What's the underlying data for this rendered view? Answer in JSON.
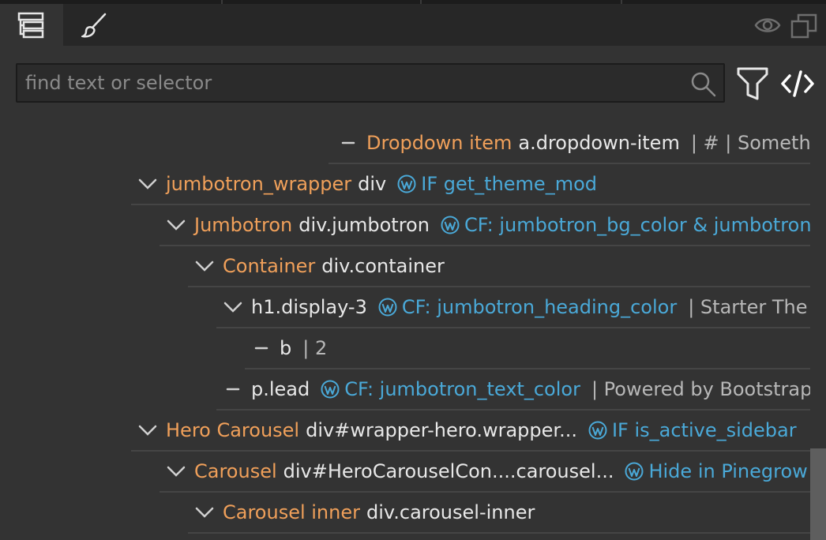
{
  "toolbar": {
    "tabs": [
      {
        "name": "tree-tab",
        "icon": "tree-icon"
      },
      {
        "name": "style-tab",
        "icon": "brush-icon"
      }
    ],
    "right_icons": [
      "eye-icon",
      "duplicate-icon"
    ]
  },
  "search": {
    "placeholder": "find text or selector",
    "value": ""
  },
  "tree": [
    {
      "indent": 0,
      "control": "leaf",
      "name": "Dropdown item",
      "selector": "a.dropdown-item",
      "meta": "| # | Someth"
    },
    {
      "indent": 0,
      "control": "expanded",
      "name": "jumbotron_wrapper",
      "selector": "div",
      "wp": "IF get_theme_mod"
    },
    {
      "indent": 1,
      "control": "expanded",
      "name": "Jumbotron",
      "selector": "div.jumbotron",
      "wp": "CF: jumbotron_bg_color & jumbotron"
    },
    {
      "indent": 2,
      "control": "expanded",
      "name": "Container",
      "selector": "div.container"
    },
    {
      "indent": 3,
      "control": "expanded",
      "name": "",
      "selector": "h1.display-3",
      "wp": "CF: jumbotron_heading_color",
      "meta": "| Starter The"
    },
    {
      "indent": 4,
      "control": "leaf",
      "name": "",
      "selector": "b",
      "meta": "| 2"
    },
    {
      "indent": 3,
      "control": "leaf",
      "name": "",
      "selector": "p.lead",
      "wp": "CF: jumbotron_text_color",
      "meta": "| Powered by Bootstrap"
    },
    {
      "indent": 0,
      "control": "expanded",
      "name": "Hero Carousel",
      "selector": "div#wrapper-hero.wrapper...",
      "wp": "IF is_active_sidebar"
    },
    {
      "indent": 1,
      "control": "expanded",
      "name": "Carousel",
      "selector": "div#HeroCarouselCon....carousel...",
      "wp": "Hide in Pinegrow"
    },
    {
      "indent": 2,
      "control": "expanded",
      "name": "Carousel inner",
      "selector": "div.carousel-inner"
    }
  ],
  "colors": {
    "background": "#333333",
    "component_name": "#f0a05a",
    "selector": "#e8e8e8",
    "wordpress_action": "#4aa9d8",
    "muted": "#8a8a8a"
  }
}
